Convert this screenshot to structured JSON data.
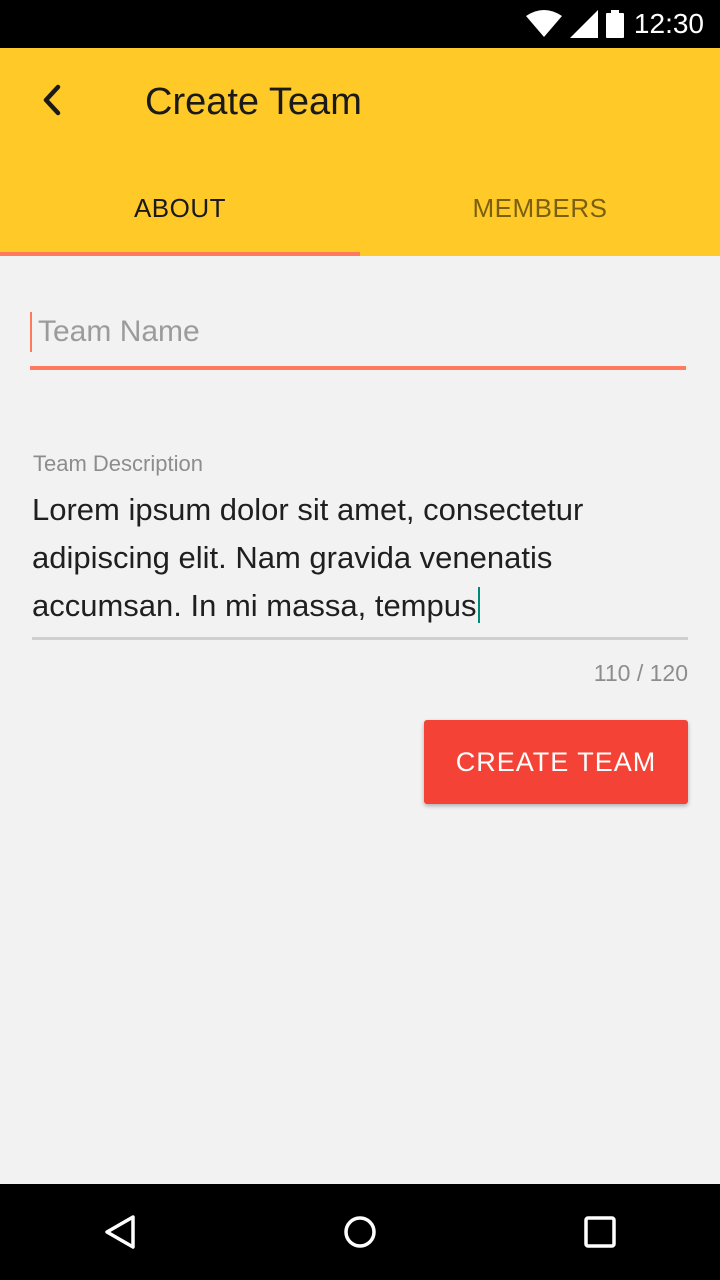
{
  "status_bar": {
    "time": "12:30",
    "icons": [
      "wifi-icon",
      "cell-signal-icon",
      "battery-icon"
    ]
  },
  "app_bar": {
    "back_icon": "back-arrow-icon",
    "title": "Create Team",
    "background_color": "#ffc928"
  },
  "tabs": [
    {
      "label": "ABOUT",
      "active": true
    },
    {
      "label": "MEMBERS",
      "active": false
    }
  ],
  "tab_indicator_color": "#ff7a5c",
  "form": {
    "team_name": {
      "value": "",
      "placeholder": "Team Name"
    },
    "team_description": {
      "label": "Team Description",
      "value": "Lorem ipsum dolor sit amet, consectetur adipiscing elit. Nam gravida venenatis accumsan. In mi massa, tempus",
      "counter": "110 / 120"
    },
    "submit_label": "CREATE TEAM",
    "submit_color": "#f44336"
  },
  "nav_bar": {
    "icons": [
      "back-triangle-icon",
      "home-circle-icon",
      "recents-square-icon"
    ]
  }
}
